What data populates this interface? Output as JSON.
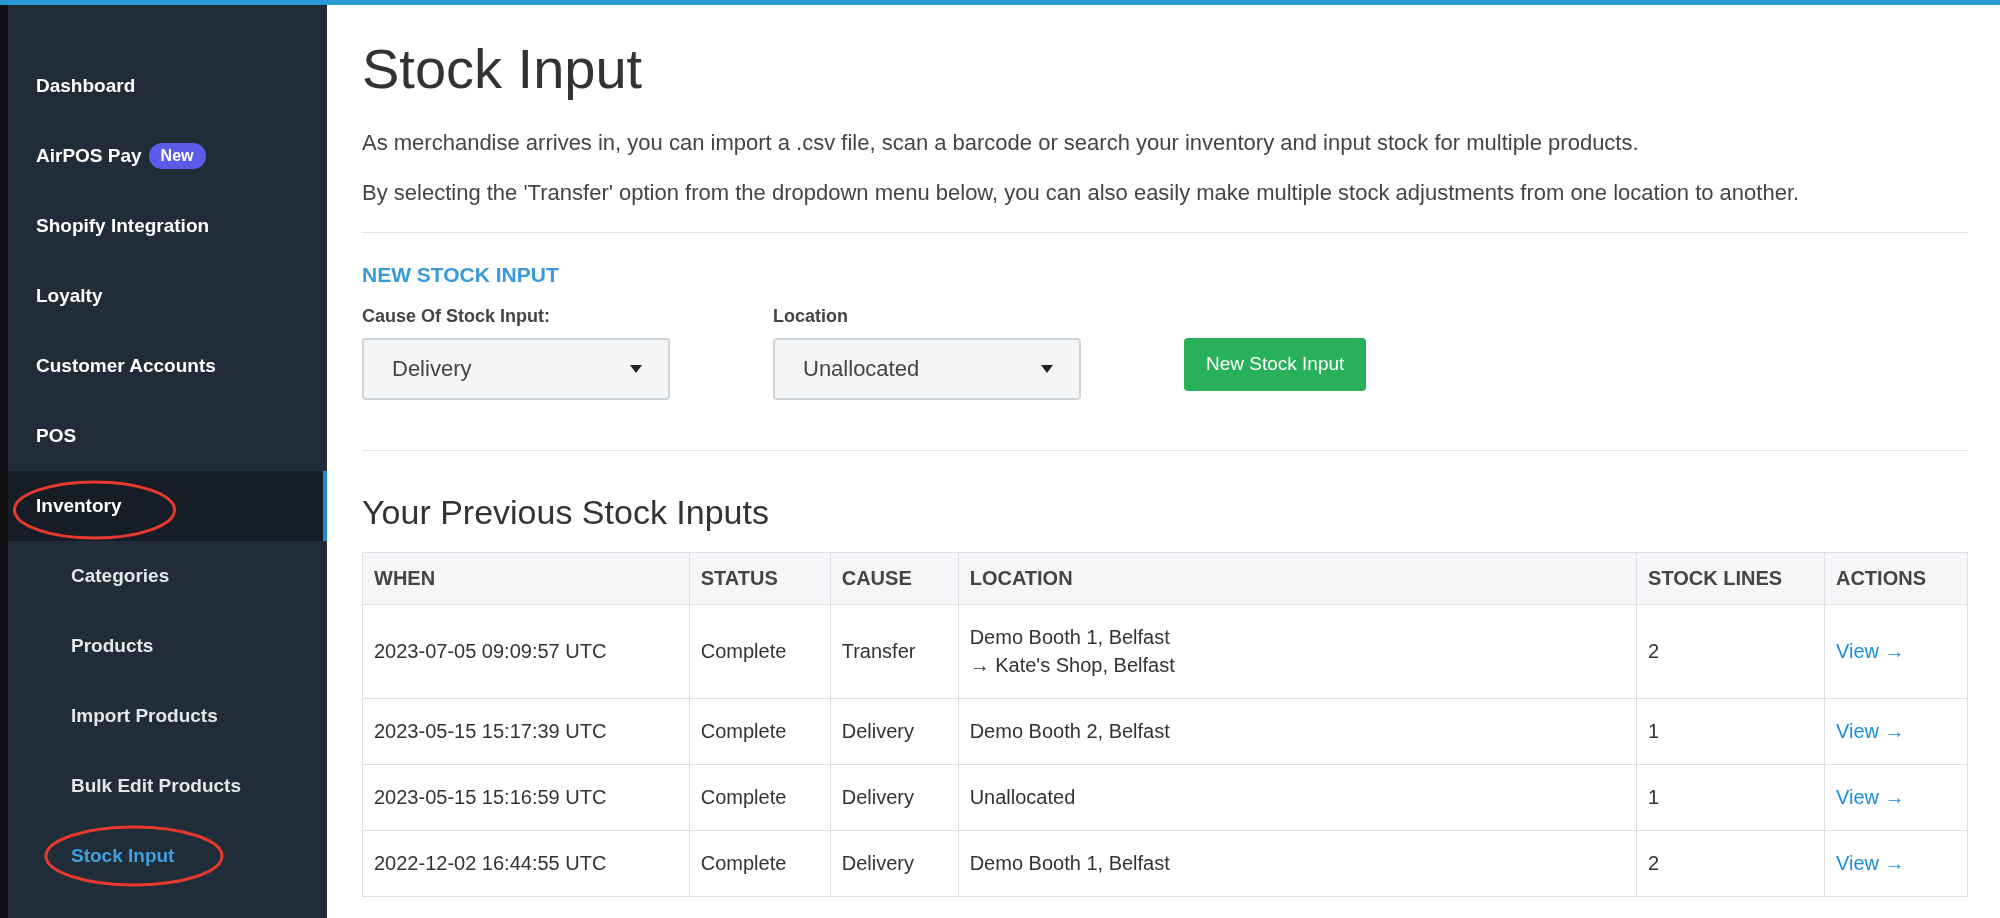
{
  "sidebar": {
    "items": [
      {
        "label": "Dashboard",
        "selected": false,
        "circled": false
      },
      {
        "label": "AirPOS Pay",
        "badge": "New",
        "selected": false,
        "circled": false
      },
      {
        "label": "Shopify Integration",
        "selected": false,
        "circled": false
      },
      {
        "label": "Loyalty",
        "selected": false,
        "circled": false
      },
      {
        "label": "Customer Accounts",
        "selected": false,
        "circled": false
      },
      {
        "label": "POS",
        "selected": false,
        "circled": false
      },
      {
        "label": "Inventory",
        "selected": true,
        "circled": true,
        "children": [
          {
            "label": "Categories",
            "selected": false,
            "circled": false
          },
          {
            "label": "Products",
            "selected": false,
            "circled": false
          },
          {
            "label": "Import Products",
            "selected": false,
            "circled": false
          },
          {
            "label": "Bulk Edit Products",
            "selected": false,
            "circled": false
          },
          {
            "label": "Stock Input",
            "selected": true,
            "circled": true
          }
        ]
      }
    ]
  },
  "page": {
    "title": "Stock Input",
    "intro": [
      "As merchandise arrives in, you can import a .csv file, scan a barcode or search your inventory and input stock for multiple products.",
      "By selecting the 'Transfer' option from the dropdown menu below, you can also easily make multiple stock adjustments from one location to another."
    ],
    "form": {
      "heading": "NEW STOCK INPUT",
      "fields": [
        {
          "label": "Cause Of Stock Input:",
          "value": "Delivery"
        },
        {
          "label": "Location",
          "value": "Unallocated"
        }
      ],
      "button": "New Stock Input"
    },
    "table": {
      "title": "Your Previous Stock Inputs",
      "columns": [
        "WHEN",
        "STATUS",
        "CAUSE",
        "LOCATION",
        "STOCK LINES",
        "ACTIONS"
      ],
      "rows": [
        {
          "when": "2023-07-05 09:09:57 UTC",
          "status": "Complete",
          "cause": "Transfer",
          "location": [
            "Demo Booth 1, Belfast",
            "→ Kate's Shop, Belfast"
          ],
          "stock_lines": "2",
          "action": "View →"
        },
        {
          "when": "2023-05-15 15:17:39 UTC",
          "status": "Complete",
          "cause": "Delivery",
          "location": [
            "Demo Booth 2, Belfast"
          ],
          "stock_lines": "1",
          "action": "View →"
        },
        {
          "when": "2023-05-15 15:16:59 UTC",
          "status": "Complete",
          "cause": "Delivery",
          "location": [
            "Unallocated"
          ],
          "stock_lines": "1",
          "action": "View →"
        },
        {
          "when": "2022-12-02 16:44:55 UTC",
          "status": "Complete",
          "cause": "Delivery",
          "location": [
            "Demo Booth 1, Belfast"
          ],
          "stock_lines": "2",
          "action": "View →"
        }
      ]
    }
  }
}
